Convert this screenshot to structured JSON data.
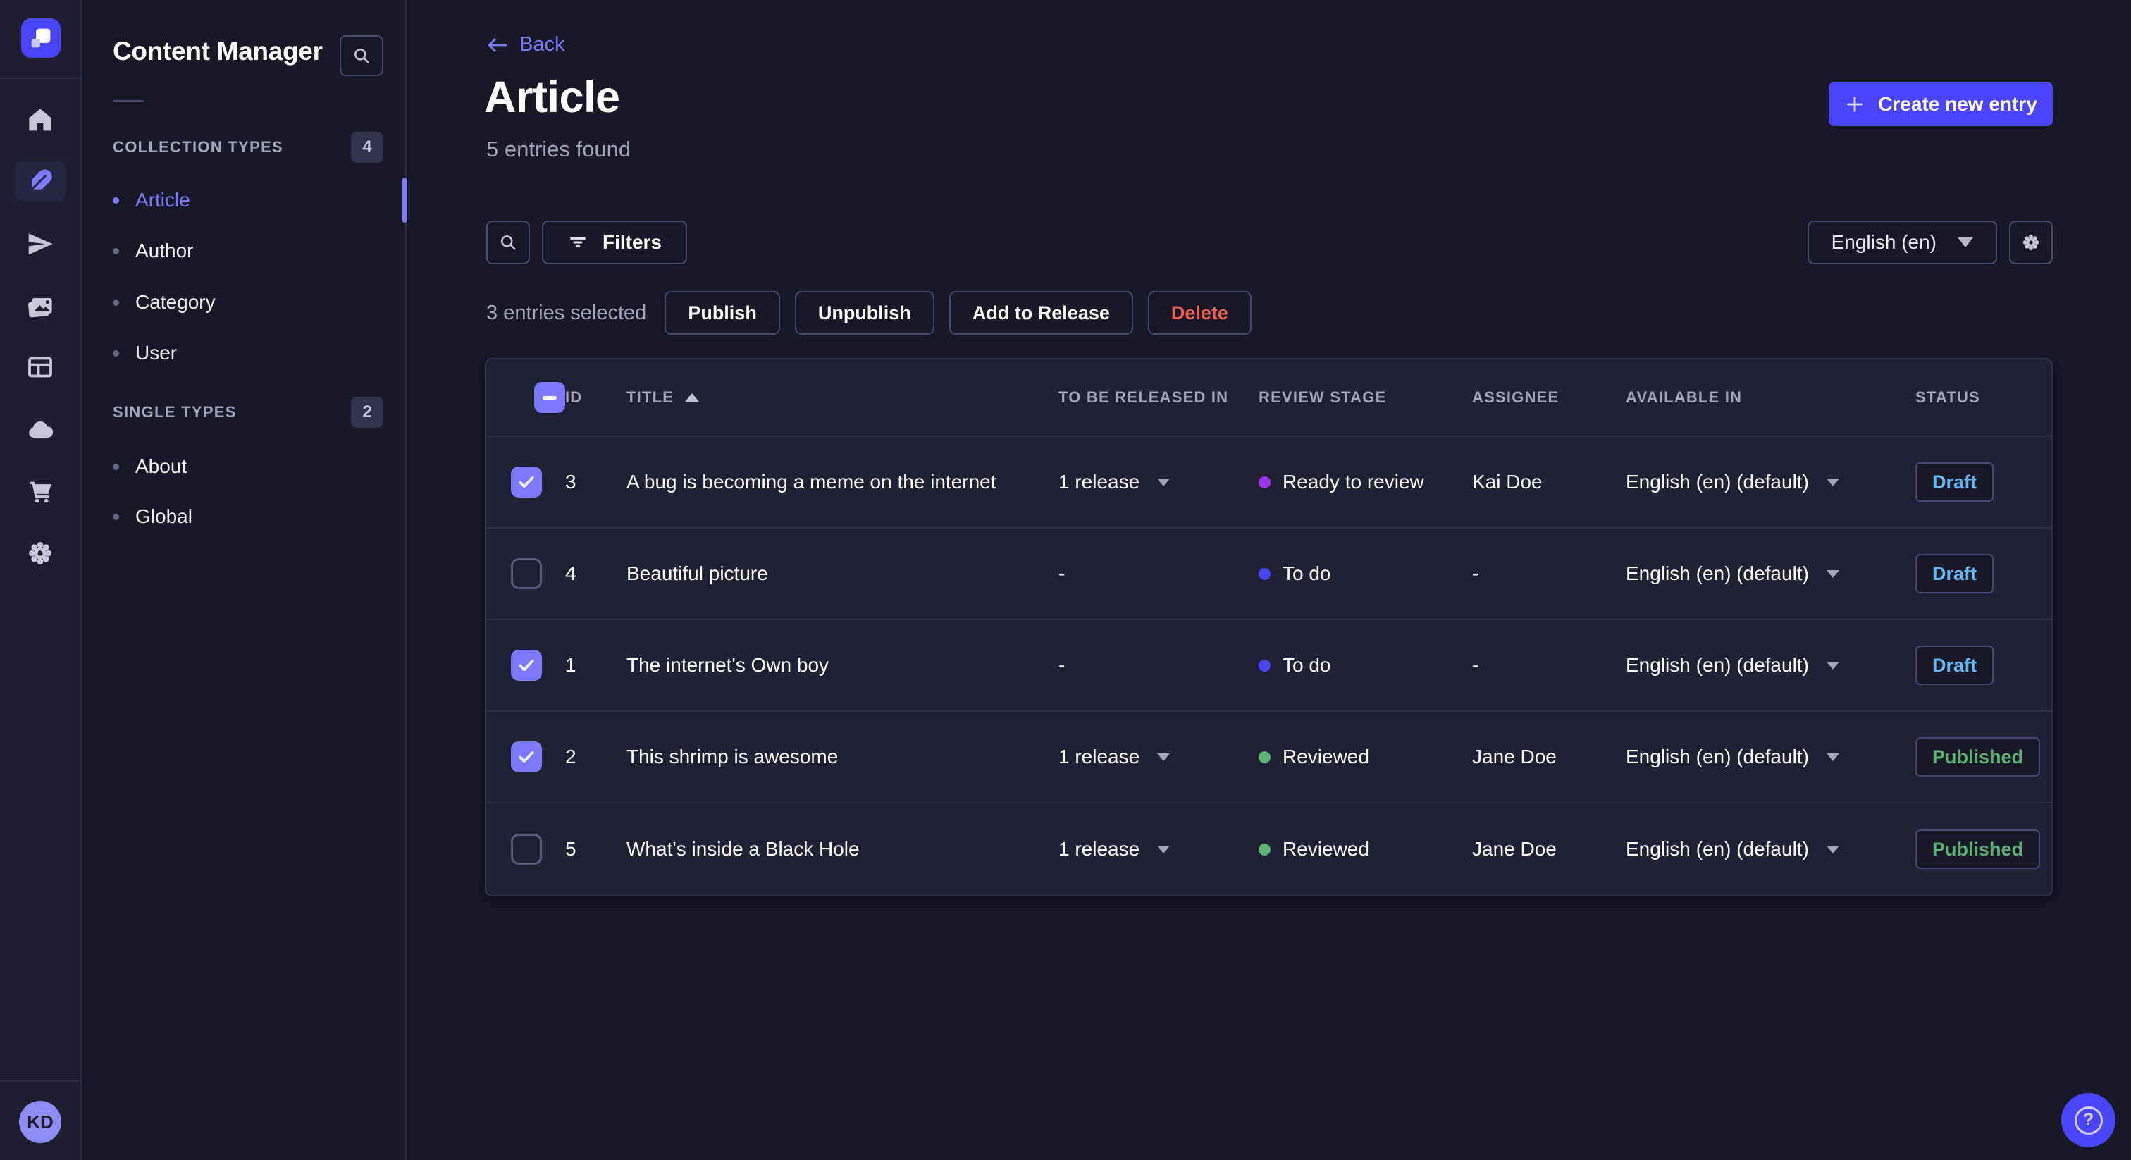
{
  "brand": {
    "primary": "#4945ff",
    "primary_light": "#7b79ff"
  },
  "nav": {
    "logo_icon": "strapi-logo",
    "avatar_initials": "KD",
    "items": [
      {
        "icon": "home-icon",
        "active": false
      },
      {
        "icon": "feather-content-icon",
        "active": true
      },
      {
        "icon": "paper-plane-icon",
        "active": false
      },
      {
        "icon": "media-library-icon",
        "active": false
      },
      {
        "icon": "layout-builder-icon",
        "active": false
      },
      {
        "icon": "cloud-icon",
        "active": false
      },
      {
        "icon": "cart-marketplace-icon",
        "active": false
      },
      {
        "icon": "gear-settings-icon",
        "active": false
      }
    ]
  },
  "subnav": {
    "title": "Content Manager",
    "sections": [
      {
        "label": "COLLECTION TYPES",
        "count": "4",
        "items": [
          {
            "label": "Article",
            "active": true
          },
          {
            "label": "Author",
            "active": false
          },
          {
            "label": "Category",
            "active": false
          },
          {
            "label": "User",
            "active": false
          }
        ]
      },
      {
        "label": "SINGLE TYPES",
        "count": "2",
        "items": [
          {
            "label": "About",
            "active": false
          },
          {
            "label": "Global",
            "active": false
          }
        ]
      }
    ]
  },
  "page": {
    "back_label": "Back",
    "title": "Article",
    "subtitle": "5 entries found",
    "create_button_label": "Create new entry"
  },
  "toolbar": {
    "filters_label": "Filters",
    "locale_value": "English (en)"
  },
  "selection": {
    "text": "3 entries selected",
    "publish_label": "Publish",
    "unpublish_label": "Unpublish",
    "add_to_release_label": "Add to Release",
    "delete_label": "Delete"
  },
  "table": {
    "header": {
      "id": "ID",
      "title": "TITLE",
      "to_be_released_in": "TO BE RELEASED IN",
      "review_stage": "REVIEW STAGE",
      "assignee": "ASSIGNEE",
      "available_in": "AVAILABLE IN",
      "status": "STATUS"
    },
    "sort": {
      "column": "TITLE",
      "direction": "asc"
    },
    "rows": [
      {
        "checked": true,
        "id": "3",
        "title": "A bug is becoming a meme on the internet",
        "to_be_released_in": "1 release",
        "has_release_dropdown": true,
        "review_stage": "Ready to review",
        "review_stage_color": "#9736e8",
        "assignee": "Kai Doe",
        "available_in": "English (en) (default)",
        "status": "Draft"
      },
      {
        "checked": false,
        "id": "4",
        "title": "Beautiful picture",
        "to_be_released_in": "-",
        "has_release_dropdown": false,
        "review_stage": "To do",
        "review_stage_color": "#4945ff",
        "assignee": "-",
        "available_in": "English (en) (default)",
        "status": "Draft"
      },
      {
        "checked": true,
        "id": "1",
        "title": "The internet's Own boy",
        "to_be_released_in": "-",
        "has_release_dropdown": false,
        "review_stage": "To do",
        "review_stage_color": "#4945ff",
        "assignee": "-",
        "available_in": "English (en) (default)",
        "status": "Draft"
      },
      {
        "checked": true,
        "id": "2",
        "title": "This shrimp is awesome",
        "to_be_released_in": "1 release",
        "has_release_dropdown": true,
        "review_stage": "Reviewed",
        "review_stage_color": "#5cb176",
        "assignee": "Jane Doe",
        "available_in": "English (en) (default)",
        "status": "Published"
      },
      {
        "checked": false,
        "id": "5",
        "title": "What's inside a Black Hole",
        "to_be_released_in": "1 release",
        "has_release_dropdown": true,
        "review_stage": "Reviewed",
        "review_stage_color": "#5cb176",
        "assignee": "Jane Doe",
        "available_in": "English (en) (default)",
        "status": "Published"
      }
    ]
  },
  "status_colors": {
    "draft_text": "#66b7f1",
    "published_text": "#5cb176",
    "danger_text": "#ee5e52"
  },
  "help": {
    "icon": "question-mark-icon"
  }
}
